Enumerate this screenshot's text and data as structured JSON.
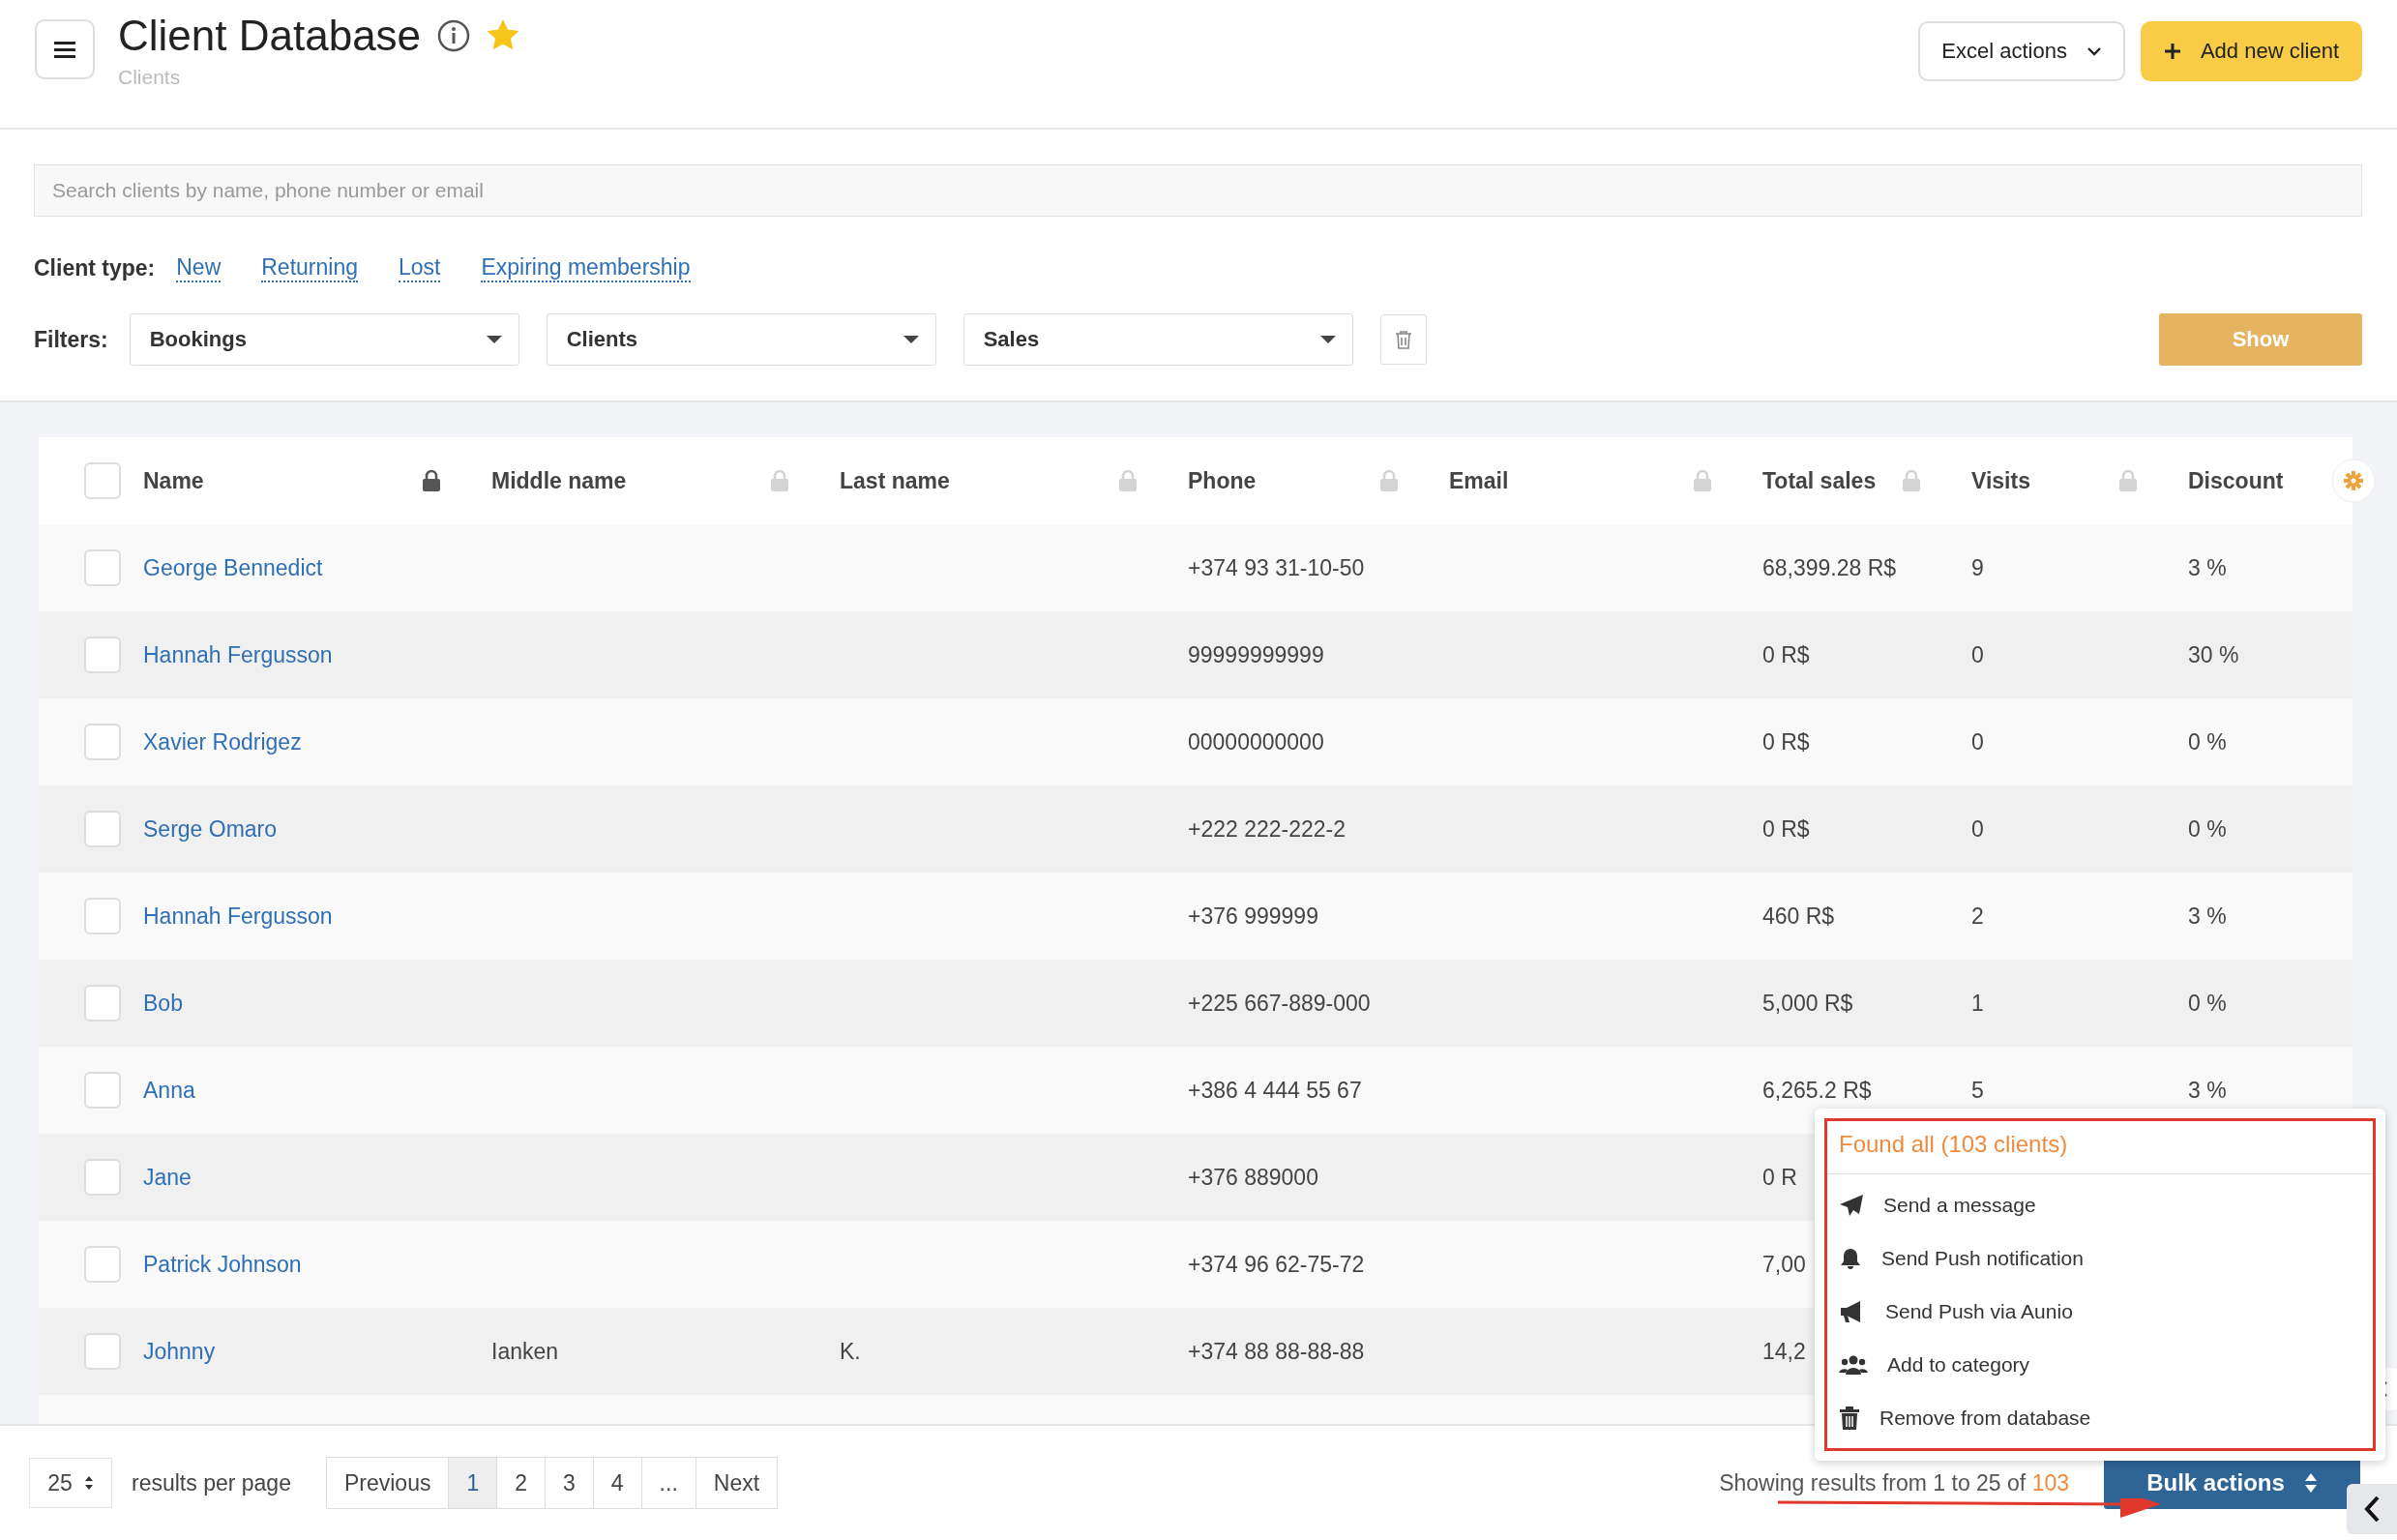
{
  "header": {
    "title": "Client Database",
    "subtitle": "Clients",
    "favorite": true,
    "excel_button": "Excel actions",
    "add_button": "Add new client"
  },
  "search": {
    "placeholder": "Search clients by name, phone number or email"
  },
  "client_type": {
    "label": "Client type:",
    "links": [
      "New",
      "Returning",
      "Lost",
      "Expiring membership"
    ]
  },
  "filters": {
    "label": "Filters:",
    "selects": [
      "Bookings",
      "Clients",
      "Sales"
    ],
    "show_button": "Show"
  },
  "table": {
    "header_checked": false,
    "columns": [
      {
        "label": "Name",
        "locked": true
      },
      {
        "label": "Middle name",
        "locked": false
      },
      {
        "label": "Last name",
        "locked": false
      },
      {
        "label": "Phone",
        "locked": false
      },
      {
        "label": "Email",
        "locked": false
      },
      {
        "label": "Total sales",
        "locked": false
      },
      {
        "label": "Visits",
        "locked": false
      },
      {
        "label": "Discount"
      }
    ],
    "rows": [
      {
        "checked": false,
        "name": "George Bennedict",
        "phone": "+374 93 31-10-50",
        "total_sales": "68,399.28 R$",
        "visits": "9",
        "discount": "3 %"
      },
      {
        "checked": false,
        "name": "Hannah Fergusson",
        "phone": "99999999999",
        "total_sales": "0 R$",
        "visits": "0",
        "discount": "30 %"
      },
      {
        "checked": false,
        "name": "Xavier Rodrigez",
        "phone": "00000000000",
        "total_sales": "0 R$",
        "visits": "0",
        "discount": "0 %"
      },
      {
        "checked": false,
        "name": "Serge Omaro",
        "phone": "+222 222-222-2",
        "total_sales": "0 R$",
        "visits": "0",
        "discount": "0 %"
      },
      {
        "checked": false,
        "name": "Hannah Fergusson",
        "phone": "+376 999999",
        "total_sales": "460 R$",
        "visits": "2",
        "discount": "3 %"
      },
      {
        "checked": false,
        "name": "Bob",
        "phone": "+225 667-889-000",
        "total_sales": "5,000 R$",
        "visits": "1",
        "discount": "0 %"
      },
      {
        "checked": false,
        "name": "Anna",
        "phone": "+386 4 444 55 67",
        "total_sales": "6,265.2 R$",
        "visits": "5",
        "discount": "3 %"
      },
      {
        "checked": false,
        "name": "Jane",
        "phone": "+376 889000",
        "total_sales": "0 R"
      },
      {
        "checked": false,
        "name": "Patrick Johnson",
        "phone": "+374 96 62-75-72",
        "total_sales": "7,00"
      },
      {
        "checked": false,
        "name": "Johnny",
        "middle_name": "Ianken",
        "last_name": "K.",
        "phone": "+374 88 88-88-88",
        "total_sales": "14,2"
      }
    ]
  },
  "bulk_menu": {
    "title": "Found all (103 clients)",
    "items": [
      {
        "kind": "message",
        "label": "Send a message"
      },
      {
        "kind": "push",
        "label": "Send Push notification"
      },
      {
        "kind": "megaphone",
        "label": "Send Push via Aunio"
      },
      {
        "kind": "category",
        "label": "Add to category"
      },
      {
        "kind": "remove",
        "label": "Remove from database"
      }
    ]
  },
  "footer": {
    "per_page": "25",
    "per_page_label": "results per page",
    "pages": [
      {
        "label": "Previous",
        "selected": false
      },
      {
        "label": "1",
        "selected": true
      },
      {
        "label": "2",
        "selected": false
      },
      {
        "label": "3",
        "selected": false
      },
      {
        "label": "4",
        "selected": false
      },
      {
        "label": "...",
        "selected": false
      },
      {
        "label": "Next",
        "selected": false
      }
    ],
    "showing": "Showing results from 1 to 25 of",
    "total": "103",
    "bulk_button": "Bulk actions"
  }
}
